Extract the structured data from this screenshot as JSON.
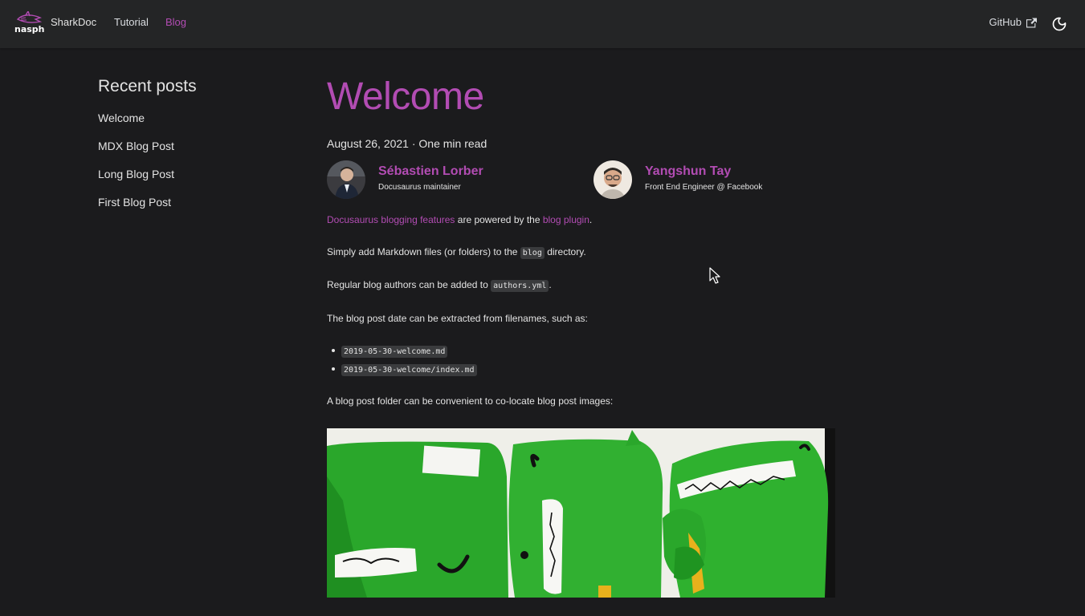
{
  "navbar": {
    "logo_text": "nasph",
    "title": "SharkDoc",
    "links": [
      {
        "label": "Tutorial",
        "active": false
      },
      {
        "label": "Blog",
        "active": true
      }
    ],
    "github_label": "GitHub",
    "icons": {
      "external": "external-link-icon",
      "theme": "moon-icon"
    }
  },
  "sidebar": {
    "title": "Recent posts",
    "items": [
      "Welcome",
      "MDX Blog Post",
      "Long Blog Post",
      "First Blog Post"
    ]
  },
  "post": {
    "title": "Welcome",
    "meta": "August 26, 2021 · One min read",
    "authors": [
      {
        "name": "Sébastien Lorber",
        "role": "Docusaurus maintainer"
      },
      {
        "name": "Yangshun Tay",
        "role": "Front End Engineer @ Facebook"
      }
    ],
    "p1": {
      "link1": "Docusaurus blogging features",
      "mid": " are powered by the ",
      "link2": "blog plugin",
      "end": "."
    },
    "p2": {
      "pre": "Simply add Markdown files (or folders) to the ",
      "code": "blog",
      "post": " directory."
    },
    "p3": {
      "pre": "Regular blog authors can be added to ",
      "code": "authors.yml",
      "post": "."
    },
    "p4": "The blog post date can be extracted from filenames, such as:",
    "files": [
      "2019-05-30-welcome.md",
      "2019-05-30-welcome/index.md"
    ],
    "p5": "A blog post folder can be convenient to co-locate blog post images:"
  },
  "colors": {
    "accent": "#b24cb3",
    "background": "#1b1b1d",
    "navbar": "#242526"
  }
}
